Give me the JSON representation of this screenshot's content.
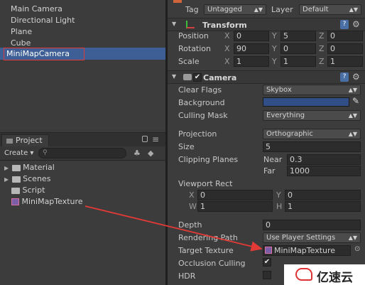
{
  "hierarchy": {
    "items": [
      "Main Camera",
      "Directional Light",
      "Plane",
      "Cube",
      "MiniMapCamera"
    ]
  },
  "project": {
    "tab": "Project",
    "create": "Create",
    "items": [
      "Material",
      "Scenes",
      "Script",
      "MiniMapTexture"
    ]
  },
  "inspector": {
    "tag_label": "Tag",
    "tag_value": "Untagged",
    "layer_label": "Layer",
    "layer_value": "Default",
    "transform": {
      "title": "Transform",
      "position": {
        "label": "Position",
        "x": "0",
        "y": "5",
        "z": "0"
      },
      "rotation": {
        "label": "Rotation",
        "x": "90",
        "y": "0",
        "z": "0"
      },
      "scale": {
        "label": "Scale",
        "x": "1",
        "y": "1",
        "z": "1"
      },
      "axis_x": "X",
      "axis_y": "Y",
      "axis_z": "Z"
    },
    "camera": {
      "title": "Camera",
      "clear_flags": {
        "label": "Clear Flags",
        "value": "Skybox"
      },
      "background": {
        "label": "Background",
        "color": "#2f4f86"
      },
      "culling_mask": {
        "label": "Culling Mask",
        "value": "Everything"
      },
      "projection": {
        "label": "Projection",
        "value": "Orthographic"
      },
      "size": {
        "label": "Size",
        "value": "5"
      },
      "clipping": {
        "label": "Clipping Planes",
        "near_label": "Near",
        "near": "0.3",
        "far_label": "Far",
        "far": "1000"
      },
      "viewport": {
        "label": "Viewport Rect",
        "x_label": "X",
        "x": "0",
        "y_label": "Y",
        "y": "0",
        "w_label": "W",
        "w": "1",
        "h_label": "H",
        "h": "1"
      },
      "depth": {
        "label": "Depth",
        "value": "0"
      },
      "rendering_path": {
        "label": "Rendering Path",
        "value": "Use Player Settings"
      },
      "target_texture": {
        "label": "Target Texture",
        "value": "MiniMapTexture"
      },
      "occlusion": {
        "label": "Occlusion Culling",
        "checked": true
      },
      "hdr": {
        "label": "HDR",
        "checked": false
      }
    }
  },
  "watermark": {
    "text": "亿速云"
  },
  "colors": {
    "selection": "#3e5f96",
    "annotation_red": "#e23a36"
  }
}
